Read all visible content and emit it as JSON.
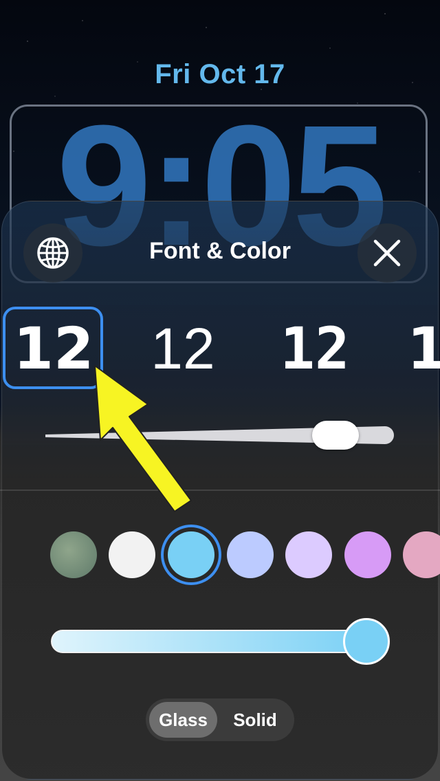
{
  "lock_screen": {
    "date": "Fri Oct 17",
    "time": "9:05"
  },
  "panel": {
    "title": "Font & Color",
    "globe_icon": "globe-icon",
    "close_icon": "close-icon"
  },
  "fonts": {
    "options": [
      "12",
      "12",
      "12",
      "1"
    ],
    "selected_index": 0
  },
  "weight_slider": {
    "value_fraction": 0.86
  },
  "colors": {
    "swatches": [
      "#7f9a7e",
      "#f2f2f2",
      "#79d0f5",
      "#bccbff",
      "#dccbff",
      "#d79bf6",
      "#e4a8c2"
    ],
    "selected_index": 2,
    "accent": "#3d8ff0"
  },
  "color_slider": {
    "value_fraction": 1.0,
    "fill_color": "#79d0f5"
  },
  "style_toggle": {
    "options": [
      "Glass",
      "Solid"
    ],
    "selected": "Glass"
  },
  "annotation": {
    "arrow_color": "#f7f423"
  }
}
